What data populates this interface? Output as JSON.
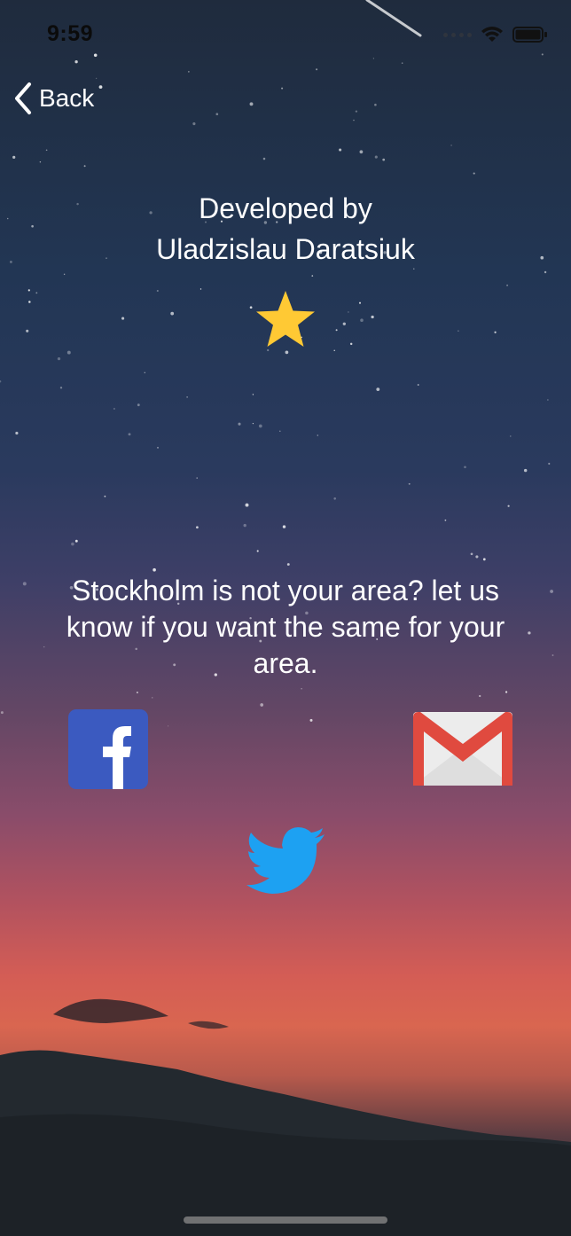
{
  "status_bar": {
    "time": "9:59"
  },
  "nav": {
    "back_label": "Back"
  },
  "credits": {
    "line1": "Developed by",
    "line2": "Uladzislau Daratsiuk"
  },
  "message": "Stockholm is not your area? let us know if you want the same for your area.",
  "social": {
    "facebook_letter": "f"
  },
  "colors": {
    "star": "#ffc934",
    "facebook": "#3b5ac0",
    "gmail_red": "#e04a3f",
    "twitter": "#1da1f2"
  }
}
